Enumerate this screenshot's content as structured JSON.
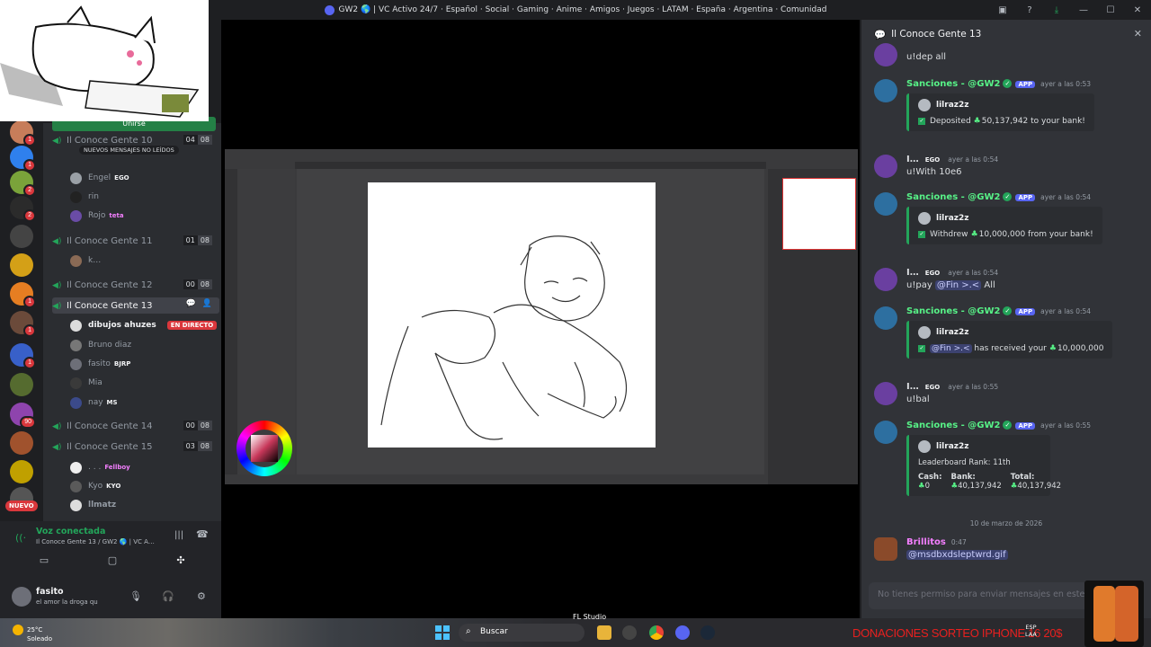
{
  "window": {
    "title": "GW2 🌎 | VC Activo 24/7 · Español · Social · Gaming · Anime · Amigos · Juegos · LATAM · España · Argentina · Comunidad"
  },
  "servers": {
    "badges": [
      "1",
      "1",
      "2",
      "2",
      "1",
      "1",
      "1",
      "90"
    ],
    "new_label": "NUEVO"
  },
  "channels": {
    "join_label": "Unirse",
    "new_messages_label": "NUEVOS MENSAJES NO LEÍDOS",
    "voice_channels": [
      {
        "name": "Il Conoce Gente 10",
        "count": "04",
        "limit": "08"
      },
      {
        "name": "Il Conoce Gente 11",
        "count": "01",
        "limit": "08"
      },
      {
        "name": "Il Conoce Gente 12",
        "count": "00",
        "limit": "08"
      },
      {
        "name": "Il Conoce Gente 13",
        "count": "",
        "limit": ""
      },
      {
        "name": "Il Conoce Gente 14",
        "count": "00",
        "limit": "08"
      },
      {
        "name": "Il Conoce Gente 15",
        "count": "03",
        "limit": "08"
      }
    ],
    "users_10": [
      {
        "name": "Engel",
        "tag": "EGO"
      },
      {
        "name": "rin",
        "tag": ""
      },
      {
        "name": "Rojo",
        "tag": "teta"
      }
    ],
    "users_11": [
      {
        "name": "k…",
        "tag": ""
      }
    ],
    "users_13": [
      {
        "name": "dibujos ahuzes",
        "tag": "",
        "live": "EN DIRECTO"
      },
      {
        "name": "Bruno diaz",
        "tag": ""
      },
      {
        "name": "fasito",
        "tag": "BJRP"
      },
      {
        "name": "Mia",
        "tag": ""
      },
      {
        "name": "nay",
        "tag": "MS"
      }
    ],
    "users_15": [
      {
        "name": ". . .",
        "tag": "Fellboy"
      },
      {
        "name": "Kyo",
        "tag": "KYO"
      },
      {
        "name": "llmatz",
        "tag": ""
      }
    ]
  },
  "voice_panel": {
    "status": "Voz conectada",
    "channel": "Il Conoce Gente 13 / GW2 🌎 | VC A…"
  },
  "user_panel": {
    "name": "fasito",
    "status": "el amor la droga qu"
  },
  "chat": {
    "header": "Il Conoce Gente 13",
    "messages": [
      {
        "author": "I…",
        "tag": "EGO",
        "time": "",
        "text": "u!dep all"
      },
      {
        "author": "Sanciones - @GW2",
        "badge": "APP",
        "time": "ayer a las 0:53",
        "embed_author": "lilraz2z",
        "embed_lines": [
          "Deposited",
          "50,137,942",
          "to your bank!"
        ]
      },
      {
        "author": "I…",
        "tag": "EGO",
        "time": "ayer a las 0:54",
        "text": "u!With 10e6"
      },
      {
        "author": "Sanciones - @GW2",
        "badge": "APP",
        "time": "ayer a las 0:54",
        "embed_author": "lilraz2z",
        "embed_lines": [
          "Withdrew",
          "10,000,000",
          "from your bank!"
        ]
      },
      {
        "author": "I…",
        "tag": "EGO",
        "time": "ayer a las 0:54",
        "text_pre": "u!pay ",
        "mention": "@Fin >.<",
        "text_post": " All"
      },
      {
        "author": "Sanciones - @GW2",
        "badge": "APP",
        "time": "ayer a las 0:54",
        "embed_author": "lilraz2z",
        "embed_mention": "@Fin >.<",
        "embed_lines": [
          "has received your",
          "10,000,000"
        ]
      },
      {
        "author": "I…",
        "tag": "EGO",
        "time": "ayer a las 0:55",
        "text": "u!bal"
      },
      {
        "author": "Sanciones - @GW2",
        "badge": "APP",
        "time": "ayer a las 0:55",
        "embed_author": "lilraz2z",
        "embed_title": "Leaderboard Rank: 11th",
        "cols": [
          {
            "h": "Cash:",
            "v": "0"
          },
          {
            "h": "Bank:",
            "v": "40,137,942"
          },
          {
            "h": "Total:",
            "v": "40,137,942"
          }
        ]
      }
    ],
    "date_divider": "10 de marzo de 2026",
    "last_message": {
      "author": "Brillitos",
      "time": "0:47",
      "mention": "@msdbxdsleptwrd.gif"
    },
    "input_placeholder": "No tienes permiso para enviar mensajes en este ca"
  },
  "taskbar": {
    "temp": "25°C",
    "weather": "Soleado",
    "search": "Buscar",
    "fl_label": "FL Studio",
    "donation": "DONACIONES SORTEO IPHONE 16 20$",
    "lang": "ESP",
    "lang2": "LAA"
  },
  "colors": {
    "accent": "#5865f2",
    "online": "#23a55a",
    "live": "#da373c",
    "donation": "#e8201f"
  }
}
